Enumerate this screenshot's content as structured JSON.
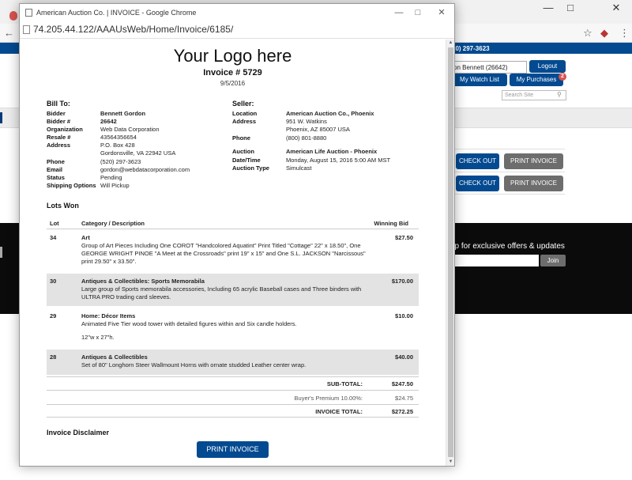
{
  "background": {
    "phone_fragment": "20) 297-3623",
    "user_fragment": "on Bennett (26642)",
    "logout": "Logout",
    "watch_list": "My Watch List",
    "purchases": "My Purchases",
    "purchases_badge": "2",
    "search_placeholder": "Search Site",
    "check_out": "CHECK OUT",
    "print_invoice": "PRINT INVOICE",
    "offer_text": "up for exclusive offers & updates",
    "join": "Join"
  },
  "popup": {
    "window_title": "American Auction Co. | INVOICE - Google Chrome",
    "url": "74.205.44.122/AAAUsWeb/Home/Invoice/6185/"
  },
  "invoice": {
    "logo": "Your Logo here",
    "number": "Invoice # 5729",
    "date": "9/5/2016",
    "bill_to_title": "Bill To:",
    "seller_title": "Seller:",
    "bill_to": [
      {
        "label": "Bidder",
        "value": "Bennett Gordon",
        "bold": true
      },
      {
        "label": "Bidder #",
        "value": "26642",
        "bold": true
      },
      {
        "label": "Organization",
        "value": "Web Data Corporation"
      },
      {
        "label": "Resale #",
        "value": "43564356654"
      },
      {
        "label": "Address",
        "value": "P.O. Box 428"
      },
      {
        "label": "",
        "value": "Gordonsville, VA 22942 USA"
      },
      {
        "label": "Phone",
        "value": "(520) 297-3623"
      },
      {
        "label": "Email",
        "value": "gordon@webdatacorporation.com"
      },
      {
        "label": "Status",
        "value": "Pending"
      },
      {
        "label": "Shipping Options",
        "value": "Will Pickup"
      }
    ],
    "seller": [
      {
        "label": "Location",
        "value": "American Auction Co., Phoenix",
        "bold": true
      },
      {
        "label": "Address",
        "value": "951 W. Watkins"
      },
      {
        "label": "",
        "value": "Phoenix, AZ 85007 USA"
      },
      {
        "label": "Phone",
        "value": "(800) 801-8880"
      },
      {
        "label": "Auction",
        "value": "American Life Auction - Phoenix",
        "bold": true
      },
      {
        "label": "Date/Time",
        "value": "Monday, August 15, 2016 5:00 AM MST"
      },
      {
        "label": "Auction Type",
        "value": "Simulcast"
      }
    ],
    "lots_title": "Lots Won",
    "columns": {
      "lot": "Lot",
      "category": "Category / Description",
      "bid": "Winning Bid"
    },
    "lots": [
      {
        "lot": "34",
        "category": "Art",
        "description": "Group of Art Pieces Including One COROT \"Handcolored Aquatint\" Print Titled \"Cottage\" 22\" x 18.50\", One GEORGE WRIGHT PINOE \"A Meet at the Crossroads\" print 19\" x 15\" and One S.L. JACKSON \"Narcissous\" print 29.50\" x 33.50\".",
        "extra": "",
        "bid": "$27.50"
      },
      {
        "lot": "30",
        "category": "Antiques & Collectibles: Sports Memorabila",
        "description": "Large group of Sports memorabila accessories, Including 65 acrylic Baseball cases and Three binders with ULTRA PRO trading card sleeves.",
        "extra": "",
        "bid": "$170.00"
      },
      {
        "lot": "29",
        "category": "Home: Décor Items",
        "description": "Animated Five Tier wood tower with detailed figures within and Six candle holders.",
        "extra": "12\"w x 27\"h.",
        "bid": "$10.00"
      },
      {
        "lot": "28",
        "category": "Antiques & Collectibles",
        "description": "Set of 80\" Longhorn Steer Wallmount Horns with ornate studded Leather center wrap.",
        "extra": "",
        "bid": "$40.00"
      }
    ],
    "subtotal_label": "SUB-TOTAL:",
    "subtotal": "$247.50",
    "premium_label": "Buyer's Premium 10.00%:",
    "premium": "$24.75",
    "total_label": "INVOICE TOTAL:",
    "total": "$272.25",
    "disclaimer_title": "Invoice Disclaimer",
    "print_button": "PRINT INVOICE"
  }
}
